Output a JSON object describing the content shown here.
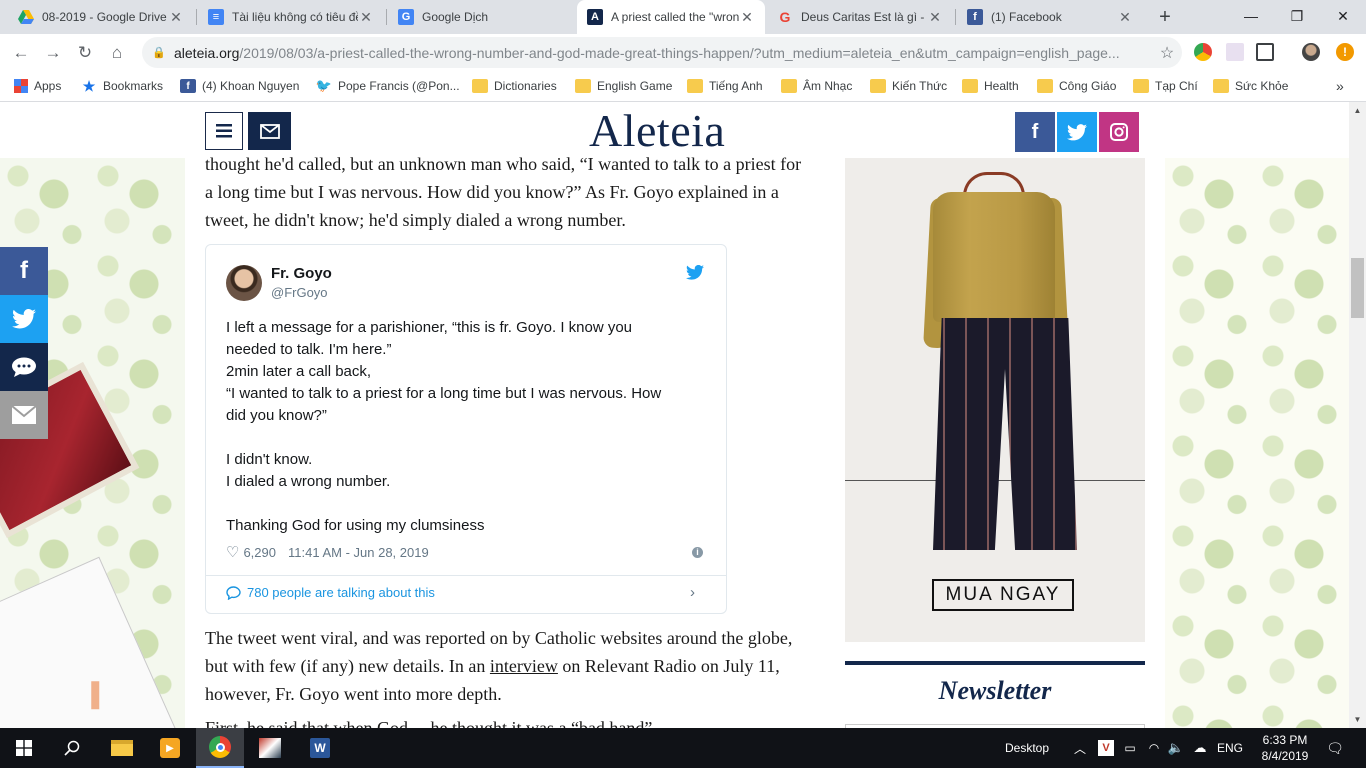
{
  "browser": {
    "tabs": [
      {
        "title": "08-2019 - Google Drive",
        "icon": "google-drive-icon",
        "color": "#1fa463"
      },
      {
        "title": "Tài liệu không có tiêu đề",
        "icon": "google-docs-icon",
        "color": "#4285f4"
      },
      {
        "title": "Google Dịch",
        "icon": "google-translate-icon",
        "color": "#4285f4"
      },
      {
        "title": "A priest called the \"wrong",
        "icon": "aleteia-icon",
        "color": "#13274b",
        "active": true
      },
      {
        "title": "Deus Caritas Est là gì - T",
        "icon": "google-icon",
        "color": "#ea4335"
      },
      {
        "title": "(1) Facebook",
        "icon": "facebook-icon",
        "color": "#3b5998"
      }
    ],
    "url_host": "aleteia.org",
    "url_path": "/2019/08/03/a-priest-called-the-wrong-number-and-god-made-great-things-happen/?utm_medium=aleteia_en&utm_campaign=english_page...",
    "bookmarks": [
      {
        "label": "Apps",
        "icon": "apps-grid-icon"
      },
      {
        "label": "Bookmarks",
        "icon": "star-icon"
      },
      {
        "label": "(4) Khoan Nguyen",
        "icon": "facebook-icon"
      },
      {
        "label": "Pope Francis (@Pon...",
        "icon": "twitter-icon"
      },
      {
        "label": "Dictionaries",
        "icon": "folder-icon"
      },
      {
        "label": "English Game",
        "icon": "folder-icon"
      },
      {
        "label": "Tiếng Anh",
        "icon": "folder-icon"
      },
      {
        "label": "Âm Nhạc",
        "icon": "folder-icon"
      },
      {
        "label": "Kiến Thức",
        "icon": "folder-icon"
      },
      {
        "label": "Health",
        "icon": "folder-icon"
      },
      {
        "label": "Công Giáo",
        "icon": "folder-icon"
      },
      {
        "label": "Tạp Chí",
        "icon": "folder-icon"
      },
      {
        "label": "Sức Khỏe",
        "icon": "folder-icon"
      }
    ]
  },
  "site": {
    "logo": "Aleteia",
    "brand_color": "#13274b",
    "facebook_color": "#3b5998",
    "twitter_color": "#1da1f2",
    "instagram_color": "#c13584"
  },
  "article": {
    "para1": "thought he'd called, but an unknown man who said, “I wanted to talk to a priest for a long time but I was nervous. How did you know?” As Fr. Goyo explained in a tweet, he didn't know; he'd simply dialed a wrong number.",
    "para2_a": "The tweet went viral, and was reported on by Catholic websites around the globe, but with few (if any) new details. In an ",
    "para2_link": "interview",
    "para2_b": " on Relevant Radio on July 11, however, Fr. Goyo went into more depth.",
    "para3": "First, he said that when God ... he thought it was a “bad hand” ..."
  },
  "tweet": {
    "name": "Fr. Goyo",
    "handle": "@FrGoyo",
    "lines": [
      "I left a message for a parishioner, “this is fr. Goyo. I know you",
      "needed to talk. I'm here.”",
      "2min later a call back,",
      "“I wanted to talk to a priest for a long time but I was nervous. How",
      "did you know?”",
      "",
      "I didn't know.",
      "I dialed a wrong number.",
      "",
      "Thanking God for using my clumsiness"
    ],
    "likes": "6,290",
    "timestamp": "11:41 AM - Jun 28, 2019",
    "talking": "780 people are talking about this"
  },
  "ad": {
    "cta": "MUA NGAY"
  },
  "newsletter": {
    "title": "Newsletter"
  },
  "taskbar": {
    "desktop_label": "Desktop",
    "language": "ENG",
    "time": "6:33 PM",
    "date": "8/4/2019"
  }
}
